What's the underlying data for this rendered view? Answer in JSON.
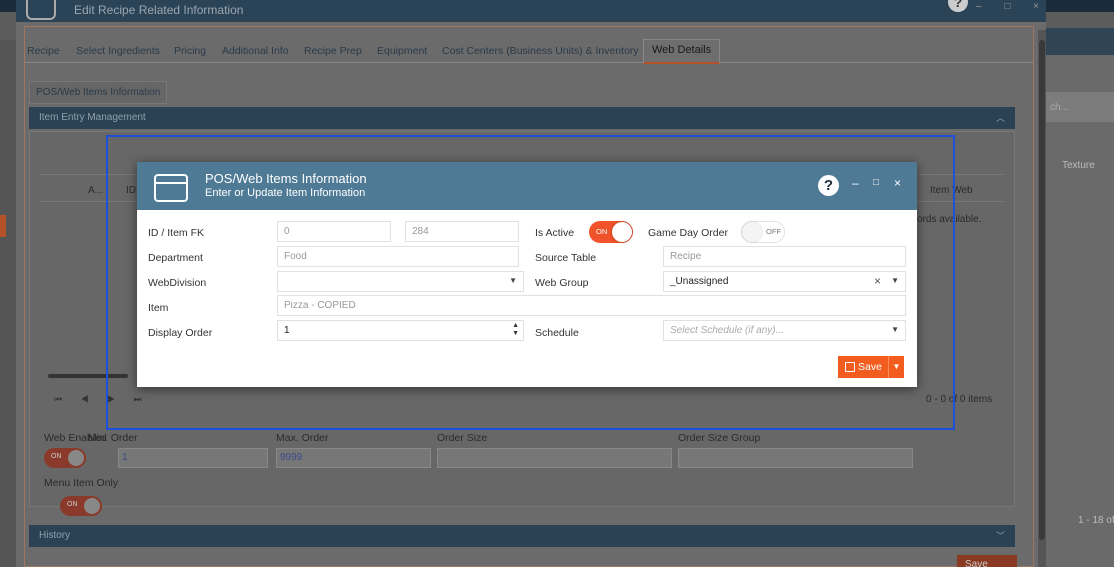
{
  "outer_window": {
    "title": "Edit Recipe Related Information",
    "help_glyph": "?",
    "controls": "– □ ×"
  },
  "tabs": [
    {
      "label": "Recipe"
    },
    {
      "label": "Select Ingredients"
    },
    {
      "label": "Pricing"
    },
    {
      "label": "Additional Info"
    },
    {
      "label": "Recipe Prep"
    },
    {
      "label": "Equipment"
    },
    {
      "label": "Cost Centers (Business Units) & Inventory"
    },
    {
      "label": "Web Details"
    }
  ],
  "subtab": "POS/Web Items Information",
  "sections": {
    "item_entry": "Item Entry Management",
    "history": "History"
  },
  "background_grid": {
    "headers": [
      "A...",
      "ID",
      "Item Web"
    ],
    "no_records": "cords available.",
    "pager": "⏮ ◀ ▶ ⏭",
    "pager_count": "0 - 0 of 0 items"
  },
  "background_form": {
    "web_enabled_label": "Web Enabled",
    "min_order_label": "Min. Order",
    "max_order_label": "Max. Order",
    "order_size_label": "Order Size",
    "order_size_group_label": "Order Size Group",
    "min_order_value": "1",
    "max_order_value": "9999",
    "menu_item_only_label": "Menu Item Only",
    "toggle_on_text": "ON"
  },
  "background_save": "Save",
  "right_panel": {
    "search_placeholder": "ch...",
    "texture_label": "Texture",
    "count": "1 - 18 of"
  },
  "modal": {
    "title": "POS/Web Items Information",
    "subtitle": "Enter or Update Item Information",
    "help_glyph": "?",
    "controls": {
      "minimize": "–",
      "maximize": "□",
      "close": "×"
    },
    "fields": {
      "id_label": "ID / Item FK",
      "id_value": "0",
      "item_fk_value": "284",
      "is_active_label": "Is Active",
      "is_active": "ON",
      "game_day_label": "Game Day Order",
      "game_day": "OFF",
      "department_label": "Department",
      "department_value": "Food",
      "source_table_label": "Source Table",
      "source_table_value": "Recipe",
      "webdivision_label": "WebDivision",
      "webdivision_value": "",
      "web_group_label": "Web Group",
      "web_group_value": "_Unassigned",
      "item_label": "Item",
      "item_value": "Pizza - COPIED",
      "display_order_label": "Display Order",
      "display_order_value": "1",
      "schedule_label": "Schedule",
      "schedule_placeholder": "Select Schedule (if any)..."
    },
    "save_label": "Save"
  },
  "colors": {
    "modal_header": "#4e7a96",
    "accent_orange": "#f25c1e",
    "selection_frame": "#1e4fd8"
  }
}
